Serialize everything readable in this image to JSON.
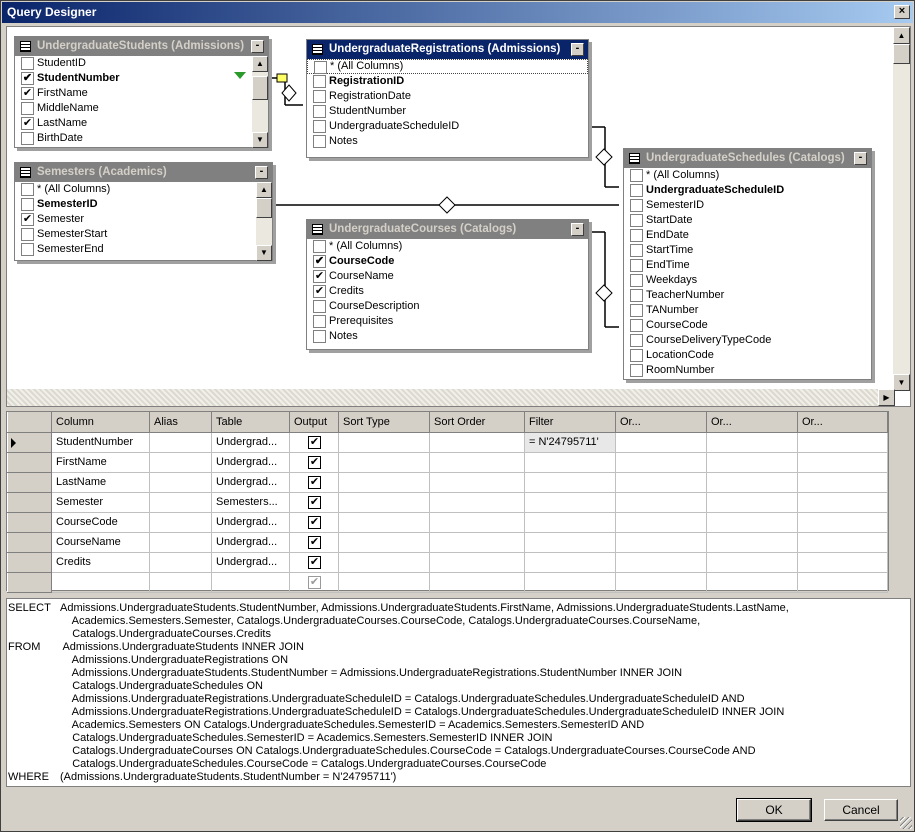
{
  "window": {
    "title": "Query Designer",
    "close_glyph": "×"
  },
  "diagram": {
    "tables": [
      {
        "id": "students",
        "title": "UndergraduateStudents (Admissions)",
        "active": false,
        "rows": [
          {
            "label": "StudentID",
            "checked": false,
            "bold": false
          },
          {
            "label": "StudentNumber",
            "checked": true,
            "bold": true,
            "filter_icon": true
          },
          {
            "label": "FirstName",
            "checked": true,
            "bold": false
          },
          {
            "label": "MiddleName",
            "checked": false,
            "bold": false
          },
          {
            "label": "LastName",
            "checked": true,
            "bold": false
          },
          {
            "label": "BirthDate",
            "checked": false,
            "bold": false
          }
        ]
      },
      {
        "id": "semesters",
        "title": "Semesters (Academics)",
        "active": false,
        "rows": [
          {
            "label": "* (All Columns)",
            "checked": false,
            "bold": false
          },
          {
            "label": "SemesterID",
            "checked": false,
            "bold": true
          },
          {
            "label": "Semester",
            "checked": true,
            "bold": false
          },
          {
            "label": "SemesterStart",
            "checked": false,
            "bold": false
          },
          {
            "label": "SemesterEnd",
            "checked": false,
            "bold": false
          }
        ]
      },
      {
        "id": "registrations",
        "title": "UndergraduateRegistrations (Admissions)",
        "active": true,
        "rows": [
          {
            "label": "* (All Columns)",
            "checked": false,
            "bold": false,
            "selected": true
          },
          {
            "label": "RegistrationID",
            "checked": false,
            "bold": true
          },
          {
            "label": "RegistrationDate",
            "checked": false,
            "bold": false
          },
          {
            "label": "StudentNumber",
            "checked": false,
            "bold": false
          },
          {
            "label": "UndergraduateScheduleID",
            "checked": false,
            "bold": false
          },
          {
            "label": "Notes",
            "checked": false,
            "bold": false
          }
        ]
      },
      {
        "id": "courses",
        "title": "UndergraduateCourses (Catalogs)",
        "active": false,
        "rows": [
          {
            "label": "* (All Columns)",
            "checked": false,
            "bold": false
          },
          {
            "label": "CourseCode",
            "checked": true,
            "bold": true
          },
          {
            "label": "CourseName",
            "checked": true,
            "bold": false
          },
          {
            "label": "Credits",
            "checked": true,
            "bold": false
          },
          {
            "label": "CourseDescription",
            "checked": false,
            "bold": false
          },
          {
            "label": "Prerequisites",
            "checked": false,
            "bold": false
          },
          {
            "label": "Notes",
            "checked": false,
            "bold": false
          }
        ]
      },
      {
        "id": "schedules",
        "title": "UndergraduateSchedules (Catalogs)",
        "active": false,
        "rows": [
          {
            "label": "* (All Columns)",
            "checked": false,
            "bold": false
          },
          {
            "label": "UndergraduateScheduleID",
            "checked": false,
            "bold": true
          },
          {
            "label": "SemesterID",
            "checked": false,
            "bold": false
          },
          {
            "label": "StartDate",
            "checked": false,
            "bold": false
          },
          {
            "label": "EndDate",
            "checked": false,
            "bold": false
          },
          {
            "label": "StartTime",
            "checked": false,
            "bold": false
          },
          {
            "label": "EndTime",
            "checked": false,
            "bold": false
          },
          {
            "label": "Weekdays",
            "checked": false,
            "bold": false
          },
          {
            "label": "TeacherNumber",
            "checked": false,
            "bold": false
          },
          {
            "label": "TANumber",
            "checked": false,
            "bold": false
          },
          {
            "label": "CourseCode",
            "checked": false,
            "bold": false
          },
          {
            "label": "CourseDeliveryTypeCode",
            "checked": false,
            "bold": false
          },
          {
            "label": "LocationCode",
            "checked": false,
            "bold": false
          },
          {
            "label": "RoomNumber",
            "checked": false,
            "bold": false
          }
        ]
      }
    ]
  },
  "grid": {
    "headers": [
      "Column",
      "Alias",
      "Table",
      "Output",
      "Sort Type",
      "Sort Order",
      "Filter",
      "Or...",
      "Or...",
      "Or..."
    ],
    "rows": [
      {
        "column": "StudentNumber",
        "alias": "",
        "table": "Undergrad...",
        "output": true,
        "sort_type": "",
        "sort_order": "",
        "filter": "= N'24795711'",
        "current": true
      },
      {
        "column": "FirstName",
        "alias": "",
        "table": "Undergrad...",
        "output": true,
        "sort_type": "",
        "sort_order": "",
        "filter": "",
        "current": false
      },
      {
        "column": "LastName",
        "alias": "",
        "table": "Undergrad...",
        "output": true,
        "sort_type": "",
        "sort_order": "",
        "filter": "",
        "current": false
      },
      {
        "column": "Semester",
        "alias": "",
        "table": "Semesters...",
        "output": true,
        "sort_type": "",
        "sort_order": "",
        "filter": "",
        "current": false
      },
      {
        "column": "CourseCode",
        "alias": "",
        "table": "Undergrad...",
        "output": true,
        "sort_type": "",
        "sort_order": "",
        "filter": "",
        "current": false
      },
      {
        "column": "CourseName",
        "alias": "",
        "table": "Undergrad...",
        "output": true,
        "sort_type": "",
        "sort_order": "",
        "filter": "",
        "current": false
      },
      {
        "column": "Credits",
        "alias": "",
        "table": "Undergrad...",
        "output": true,
        "sort_type": "",
        "sort_order": "",
        "filter": "",
        "current": false
      },
      {
        "column": "",
        "alias": "",
        "table": "",
        "output": true,
        "sort_type": "",
        "sort_order": "",
        "filter": "",
        "current": false,
        "new_row": true
      }
    ]
  },
  "sql": [
    {
      "kw": "SELECT",
      "text": "Admissions.UndergraduateStudents.StudentNumber, Admissions.UndergraduateStudents.FirstName, Admissions.UndergraduateStudents.LastName,"
    },
    {
      "kw": "",
      "text": "    Academics.Semesters.Semester, Catalogs.UndergraduateCourses.CourseCode, Catalogs.UndergraduateCourses.CourseName,"
    },
    {
      "kw": "",
      "text": "    Catalogs.UndergraduateCourses.Credits"
    },
    {
      "kw": "FROM",
      "text": " Admissions.UndergraduateStudents INNER JOIN"
    },
    {
      "kw": "",
      "text": "    Admissions.UndergraduateRegistrations ON"
    },
    {
      "kw": "",
      "text": "    Admissions.UndergraduateStudents.StudentNumber = Admissions.UndergraduateRegistrations.StudentNumber INNER JOIN"
    },
    {
      "kw": "",
      "text": "    Catalogs.UndergraduateSchedules ON"
    },
    {
      "kw": "",
      "text": "    Admissions.UndergraduateRegistrations.UndergraduateScheduleID = Catalogs.UndergraduateSchedules.UndergraduateScheduleID AND"
    },
    {
      "kw": "",
      "text": "    Admissions.UndergraduateRegistrations.UndergraduateScheduleID = Catalogs.UndergraduateSchedules.UndergraduateScheduleID INNER JOIN"
    },
    {
      "kw": "",
      "text": "    Academics.Semesters ON Catalogs.UndergraduateSchedules.SemesterID = Academics.Semesters.SemesterID AND"
    },
    {
      "kw": "",
      "text": "    Catalogs.UndergraduateSchedules.SemesterID = Academics.Semesters.SemesterID INNER JOIN"
    },
    {
      "kw": "",
      "text": "    Catalogs.UndergraduateCourses ON Catalogs.UndergraduateSchedules.CourseCode = Catalogs.UndergraduateCourses.CourseCode AND"
    },
    {
      "kw": "",
      "text": "    Catalogs.UndergraduateSchedules.CourseCode = Catalogs.UndergraduateCourses.CourseCode"
    },
    {
      "kw": "WHERE",
      "text": "(Admissions.UndergraduateStudents.StudentNumber = N'24795711')"
    }
  ],
  "buttons": {
    "ok": "OK",
    "cancel": "Cancel"
  }
}
